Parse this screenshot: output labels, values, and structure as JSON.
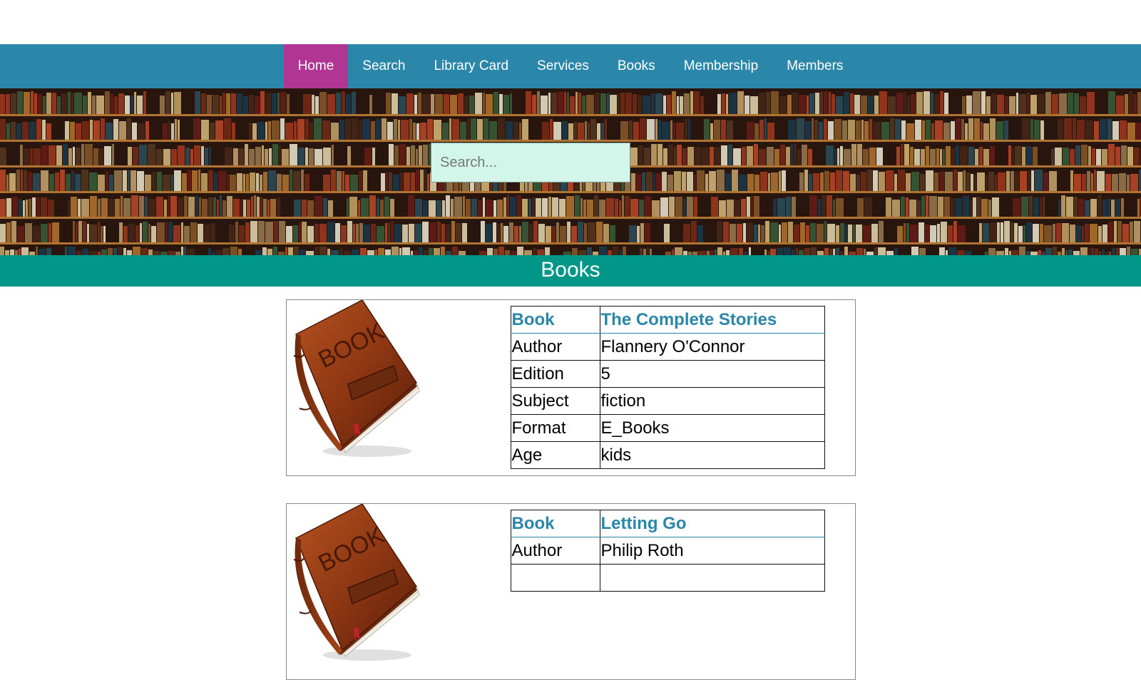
{
  "nav": {
    "items": [
      {
        "label": "Home",
        "active": true
      },
      {
        "label": "Search"
      },
      {
        "label": "Library Card"
      },
      {
        "label": "Services"
      },
      {
        "label": "Books"
      },
      {
        "label": "Membership"
      },
      {
        "label": "Members"
      }
    ]
  },
  "search": {
    "placeholder": "Search..."
  },
  "section": {
    "title": "Books"
  },
  "colors": {
    "nav_bg": "#2b87aa",
    "nav_active": "#b13593",
    "section_bg": "#009688",
    "search_bg": "#d3f6ea"
  },
  "books": [
    {
      "book_label": "Book",
      "title": "The Complete Stories",
      "author_label": "Author",
      "author": "Flannery O'Connor",
      "edition_label": "Edition",
      "edition": "5",
      "subject_label": "Subject",
      "subject": "fiction",
      "format_label": "Format",
      "format": "E_Books",
      "age_label": "Age",
      "age": "kids",
      "image_icon": "book-icon"
    },
    {
      "book_label": "Book",
      "title": "Letting Go",
      "author_label": "Author",
      "author": "Philip Roth",
      "image_icon": "book-icon"
    }
  ]
}
